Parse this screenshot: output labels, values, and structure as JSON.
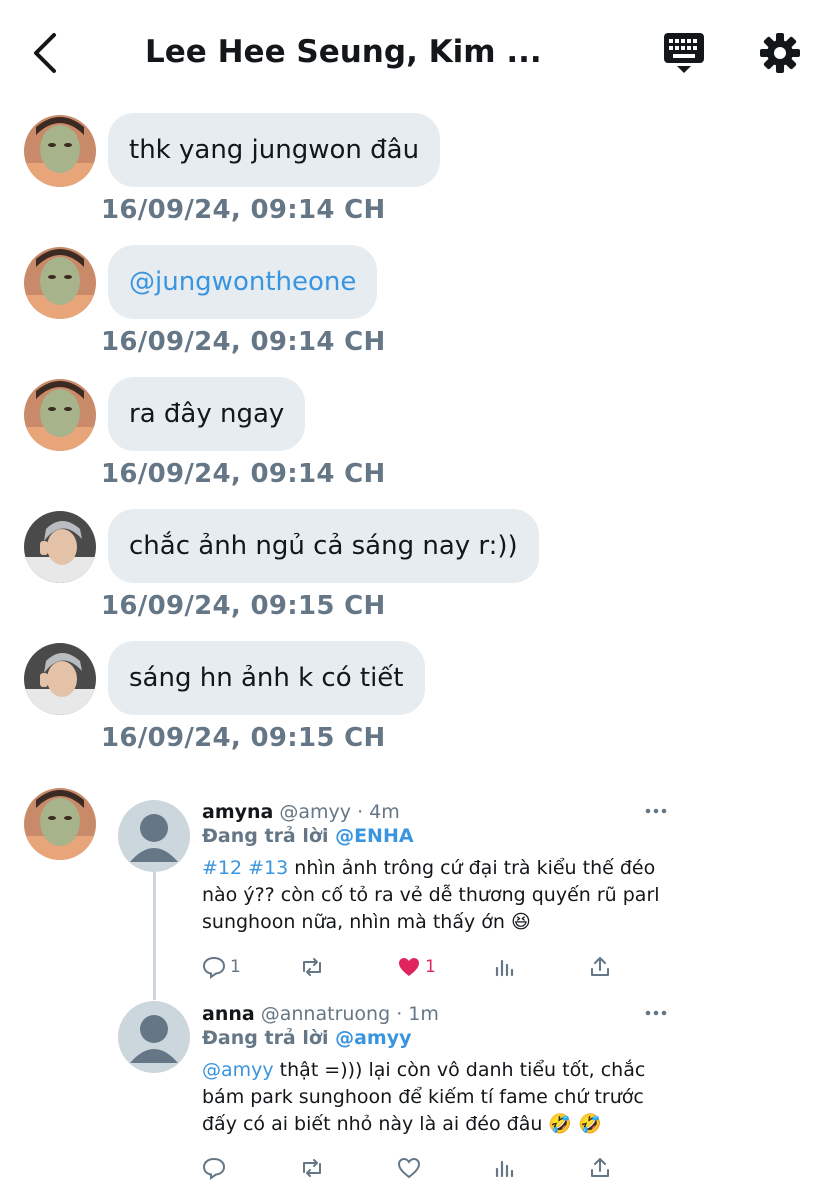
{
  "header": {
    "title": "Lee Hee Seung, Kim ...",
    "back_icon": "chevron-left-icon",
    "keyboard_icon": "keyboard-icon",
    "settings_icon": "gear-icon"
  },
  "messages": [
    {
      "text": "thk yang jungwon đâu",
      "timestamp": "16/09/24, 09:14 CH",
      "avatar": "face-mask-avatar",
      "is_link": false
    },
    {
      "text": "@jungwontheone",
      "timestamp": "16/09/24, 09:14 CH",
      "avatar": "face-mask-avatar",
      "is_link": true
    },
    {
      "text": "ra đây ngay",
      "timestamp": "16/09/24, 09:14 CH",
      "avatar": "face-mask-avatar",
      "is_link": false
    },
    {
      "text": "chắc ảnh ngủ cả sáng nay r:))",
      "timestamp": "16/09/24, 09:15 CH",
      "avatar": "grey-hair-avatar",
      "is_link": false
    },
    {
      "text": "sáng hn ảnh k có tiết",
      "timestamp": "16/09/24, 09:15 CH",
      "avatar": "grey-hair-avatar",
      "is_link": false
    }
  ],
  "shared_tweets": [
    {
      "name": "amyna",
      "handle": "@amyy · 4m",
      "reply_prefix": "Đang trả lời",
      "reply_to": "@ENHA",
      "tags": "#12 #13",
      "text": " nhìn ảnh trông cứ đại trà kiểu thế đéo nào ý?? còn cố tỏ ra vẻ dễ thương quyến rũ parl sunghoon nữa, nhìn mà thấy ớn 😆",
      "reply_count": "1",
      "like_count": "1",
      "liked": true
    },
    {
      "name": "anna",
      "handle": "@annatruong · 1m",
      "reply_prefix": "Đang trả lời",
      "reply_to": "@amyy",
      "tags": "@amyy",
      "text": " thật =))) lại còn vô danh tiểu tốt, chắc bám park sunghoon để kiếm tí fame chứ trước đấy có ai biết nhỏ này là ai đéo đâu 🤣 🤣",
      "reply_count": "",
      "like_count": "",
      "liked": false
    }
  ],
  "colors": {
    "bubble": "#e6ecf0",
    "timestamp": "#657786",
    "link": "#3a95e0",
    "like": "#e0245e"
  }
}
